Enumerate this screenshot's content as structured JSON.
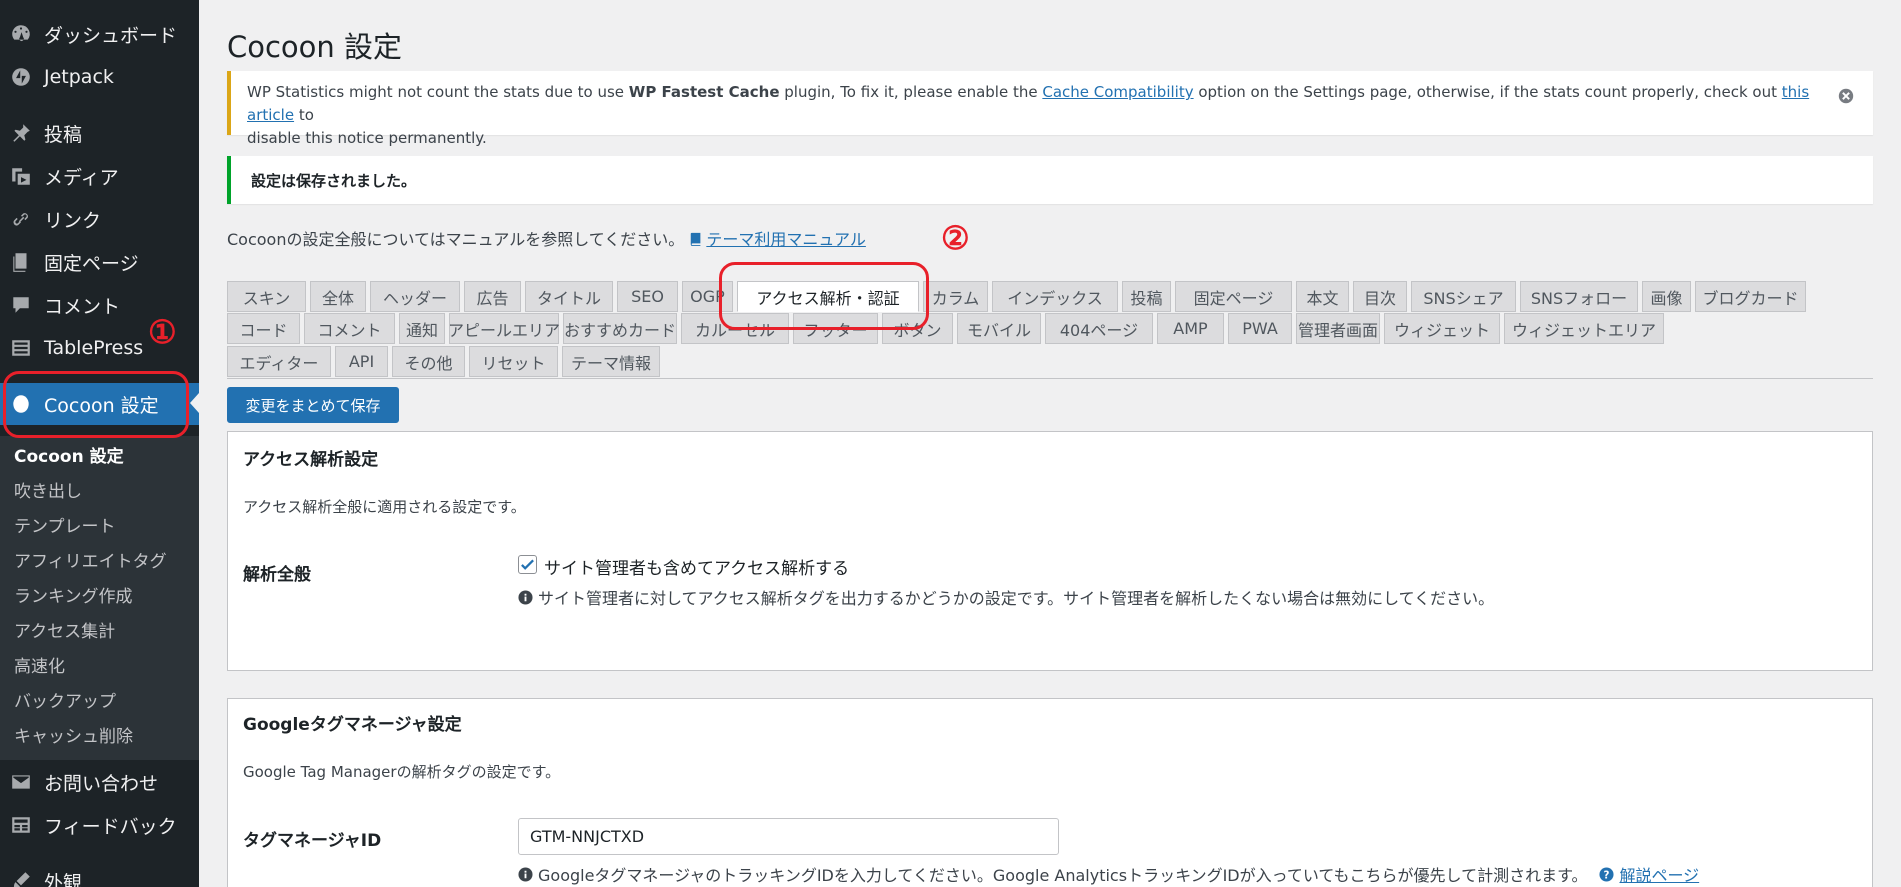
{
  "sidebar": {
    "items": [
      {
        "label": "ダッシュボード",
        "icon": "dashboard-icon"
      },
      {
        "label": "Jetpack",
        "icon": "jetpack-icon"
      },
      {
        "label": "投稿",
        "icon": "pin-icon"
      },
      {
        "label": "メディア",
        "icon": "media-icon"
      },
      {
        "label": "リンク",
        "icon": "link-icon"
      },
      {
        "label": "固定ページ",
        "icon": "page-icon"
      },
      {
        "label": "コメント",
        "icon": "comment-icon"
      },
      {
        "label": "TablePress",
        "icon": "table-icon"
      },
      {
        "label": "Cocoon 設定",
        "icon": "cocoon-icon",
        "active": true
      },
      {
        "label": "お問い合わせ",
        "icon": "mail-icon"
      },
      {
        "label": "フィードバック",
        "icon": "feedback-icon"
      },
      {
        "label": "外観",
        "icon": "appearance-icon"
      }
    ],
    "submenu": [
      "Cocoon 設定",
      "吹き出し",
      "テンプレート",
      "アフィリエイトタグ",
      "ランキング作成",
      "アクセス集計",
      "高速化",
      "バックアップ",
      "キャッシュ削除"
    ]
  },
  "annotations": {
    "one": "①",
    "two": "②",
    "color": "#e8202a"
  },
  "page": {
    "title": "Cocoon 設定"
  },
  "notice_warning": {
    "text_1": "WP Statistics might not count the stats due to use ",
    "plugin": "WP Fastest Cache",
    "text_2": " plugin, To fix it, please enable the ",
    "link_1": "Cache Compatibility",
    "text_3": " option on the Settings page, otherwise, if the stats count properly, check out ",
    "link_2": "this article",
    "text_4": " to",
    "text_5": "disable this notice permanently."
  },
  "notice_success": {
    "text": "設定は保存されました。"
  },
  "manual": {
    "text": "Cocoonの設定全般についてはマニュアルを参照してください。",
    "link": "テーマ利用マニュアル"
  },
  "tabs": {
    "row1": [
      "スキン",
      "全体",
      "ヘッダー",
      "広告",
      "タイトル",
      "SEO",
      "OGP",
      "アクセス解析・認証",
      "カラム",
      "インデックス",
      "投稿",
      "固定ページ",
      "本文",
      "目次",
      "SNSシェア",
      "SNSフォロー",
      "画像",
      "ブログカード"
    ],
    "row2": [
      "コード",
      "コメント",
      "通知",
      "アピールエリア",
      "おすすめカード",
      "カルーセル",
      "フッター",
      "ボタン",
      "モバイル",
      "404ページ",
      "AMP",
      "PWA",
      "管理者画面",
      "ウィジェット",
      "ウィジェットエリア"
    ],
    "row3": [
      "エディター",
      "API",
      "その他",
      "リセット",
      "テーマ情報"
    ],
    "active": "アクセス解析・認証"
  },
  "save_button": "変更をまとめて保存",
  "access_panel": {
    "title": "アクセス解析設定",
    "desc": "アクセス解析全般に適用される設定です。",
    "row_label": "解析全般",
    "checkbox_label": "サイト管理者も含めてアクセス解析する",
    "checked": true,
    "help": "サイト管理者に対してアクセス解析タグを出力するかどうかの設定です。サイト管理者を解析したくない場合は無効にしてください。"
  },
  "gtm_panel": {
    "title": "Googleタグマネージャ設定",
    "desc": "Google Tag Managerの解析タグの設定です。",
    "row_label": "タグマネージャID",
    "input_value": "GTM-NNJCTXD",
    "help": "GoogleタグマネージャのトラッキングIDを入力してください。Google AnalyticsトラッキングIDが入っていてもこちらが優先して計測されます。",
    "help_link": "解説ページ"
  },
  "colors": {
    "sidebar": "#1d2327",
    "submenu": "#2c3338",
    "accent": "#2271b1",
    "warning": "#dba617",
    "success": "#00a32a"
  }
}
